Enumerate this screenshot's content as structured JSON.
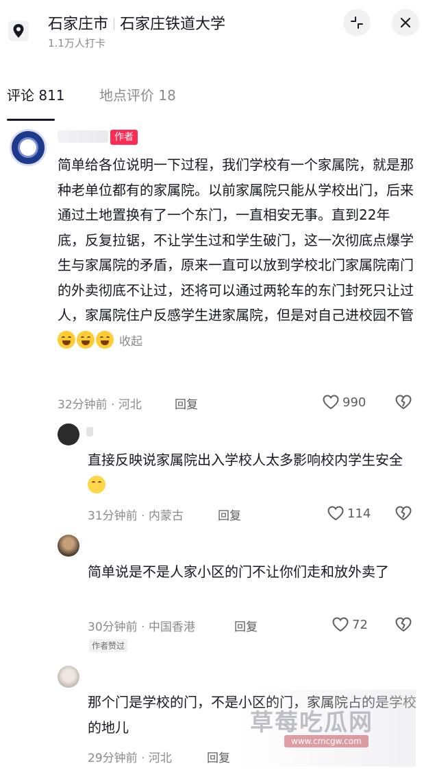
{
  "header": {
    "city": "石家庄市",
    "place": "石家庄铁道大学",
    "checkins": "1.1万人打卡"
  },
  "tabs": [
    {
      "label": "评论 811",
      "active": true
    },
    {
      "label": "地点评价 18",
      "active": false
    }
  ],
  "main_comment": {
    "badge": "作者",
    "text": "简单给各位说明一下过程，我们学校有一个家属院，就是那种老单位都有的家属院。以前家属院只能从学校出门，后来通过土地置换有了一个东门，一直相安无事。直到22年底，反复拉锯，不让学生过和学生破门，这一次彻底点爆学生与家属院的矛盾，原来一直可以放到学校北门家属院南门的外卖彻底不让过，还将可以通过两轮车的东门封死只让过人，家属院住户反感学生进家属院，但是对自己进校园不管",
    "collapse": "收起",
    "time_location": "32分钟前 · 河北",
    "reply": "回复",
    "likes": "990"
  },
  "replies": [
    {
      "text": "直接反映说家属院出入学校人太多影响校内学生安全",
      "time_location": "31分钟前 · 内蒙古",
      "reply": "回复",
      "likes": "114"
    },
    {
      "text": "简单说是不是人家小区的门不让你们走和放外卖了",
      "time_location": "30分钟前 · 中国香港",
      "reply": "回复",
      "likes": "72",
      "badge": "作者赞过"
    },
    {
      "text": "那个门是学校的门，不是小区的门，家属院占的是学校的地儿",
      "time_location": "29分钟前 · 河北",
      "reply": "回复"
    }
  ],
  "watermark": {
    "text": "草莓吃瓜网",
    "url": "www.cmcgw.com"
  },
  "colors": {
    "author_badge": "#fe2c55",
    "muted_text": "#8a8b91",
    "primary_text": "#161823"
  }
}
